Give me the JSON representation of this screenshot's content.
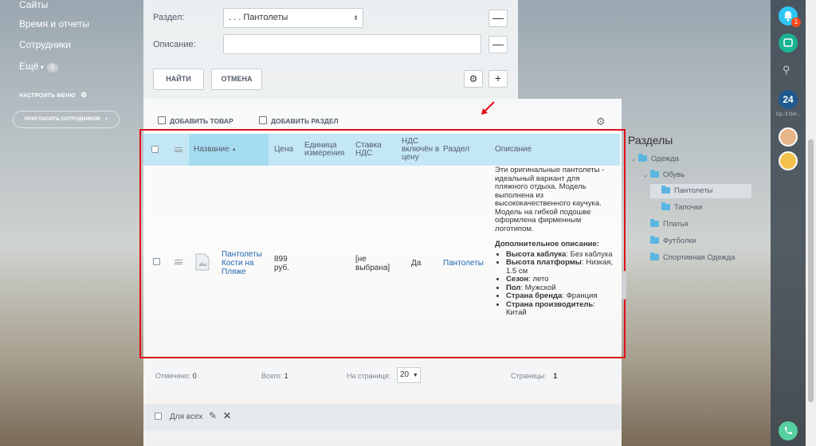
{
  "left_menu": {
    "items": [
      {
        "label": "Сайты"
      },
      {
        "label": "Время и отчеты"
      },
      {
        "label": "Сотрудники"
      },
      {
        "label": "Ещё"
      }
    ],
    "more_counter": "6",
    "setup_menu": "НАСТРОИТЬ МЕНЮ",
    "invite": "ПРИГЛАСИТЬ СОТРУДНИКОВ"
  },
  "filter": {
    "section_label": "Раздел:",
    "section_value": ". . . Пантолеты",
    "description_label": "Описание:",
    "description_value": "",
    "find_button": "НАЙТИ",
    "cancel_button": "ОТМЕНА"
  },
  "toolbar": {
    "add_product": "ДОБАВИТЬ ТОВАР",
    "add_section": "ДОБАВИТЬ РАЗДЕЛ"
  },
  "grid": {
    "columns": [
      "Название",
      "Цена",
      "Единица измерения",
      "Ставка НДС",
      "НДС включён в цену",
      "Раздел",
      "Описание"
    ],
    "sort_indicator": "▲",
    "row": {
      "name": "Пантолеты Кости на Пляже",
      "price": "899 руб.",
      "unit": "",
      "vat_rate": "[не выбрана]",
      "vat_included": "Да",
      "section": "Пантолеты",
      "description_intro": "Эти оригинальные пантолеты - идеальный вариант для пляжного отдыха. Модель выполнена из высококачественного каучука. Модель на гибкой подошве оформлена фирменным логотипом.",
      "description_extra_title": "Дополнительное описание:",
      "description_props": [
        {
          "key": "Высота каблука",
          "value": "Без каблука"
        },
        {
          "key": "Высота платформы",
          "value": "Низкая, 1.5 см"
        },
        {
          "key": "Сезон",
          "value": "лето"
        },
        {
          "key": "Пол",
          "value": "Мужской"
        },
        {
          "key": "Страна бренда",
          "value": "Франция"
        },
        {
          "key": "Страна производитель",
          "value": "Китай"
        }
      ]
    }
  },
  "footer": {
    "marked_label": "Отмечено:",
    "marked_value": "0",
    "total_label": "Всего:",
    "total_value": "1",
    "per_page_label": "На странице:",
    "per_page_value": "20",
    "pages_label": "Страницы:",
    "pages_value": "1"
  },
  "bottom_bar": {
    "for_all": "Для всех"
  },
  "sections_panel": {
    "title": "Разделы",
    "tree": [
      "Одежда",
      "Обувь",
      "Пантолеты",
      "Тапочки",
      "Платья",
      "Футболки",
      "Спортивная Одежда"
    ]
  },
  "right_bar": {
    "notification_count": "1",
    "calendar_day": "24",
    "calendar_date": "Ср, 3 Окт..."
  },
  "colors": {
    "accent_link": "#2067b0",
    "header_bg": "#c4e7f5",
    "highlight_frame": "#e0101a",
    "folder": "#5ab6e0"
  }
}
